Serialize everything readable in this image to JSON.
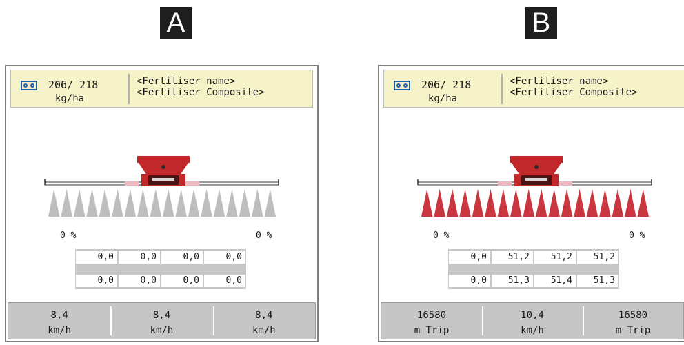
{
  "panels": [
    {
      "letter": "A",
      "rate_value": "206/ 218",
      "rate_unit": "kg/ha",
      "fertiliser_name": "<Fertiliser name>",
      "fertiliser_composite": "<Fertiliser Composite>",
      "spread_active": false,
      "pct_left": "0 %",
      "pct_right": "0 %",
      "grid_row1": [
        "0,0",
        "0,0",
        "0,0",
        "0,0"
      ],
      "grid_row2": [
        "0,0",
        "0,0",
        "0,0",
        "0,0"
      ],
      "footer": [
        {
          "value": "8,4",
          "unit": "km/h"
        },
        {
          "value": "8,4",
          "unit": "km/h"
        },
        {
          "value": "8,4",
          "unit": "km/h"
        }
      ]
    },
    {
      "letter": "B",
      "rate_value": "206/ 218",
      "rate_unit": "kg/ha",
      "fertiliser_name": "<Fertiliser name>",
      "fertiliser_composite": "<Fertiliser Composite>",
      "spread_active": true,
      "pct_left": "0 %",
      "pct_right": "0 %",
      "grid_row1": [
        "0,0",
        "51,2",
        "51,2",
        "51,2"
      ],
      "grid_row2": [
        "0,0",
        "51,3",
        "51,4",
        "51,3"
      ],
      "footer": [
        {
          "value": "16580",
          "unit": "m Trip"
        },
        {
          "value": "10,4",
          "unit": "km/h"
        },
        {
          "value": "16580",
          "unit": "m Trip"
        }
      ]
    }
  ],
  "colors": {
    "header_bg": "#f6f3c8",
    "machine_red": "#c0282b",
    "spread_active": "#c4202a",
    "spread_inactive": "#a8a8a8",
    "rate_icon": "#1f5fa8"
  },
  "icons": {
    "rate": "rate-meter-icon",
    "machine": "spreader-machine-icon",
    "spread": "spread-fan-icon"
  }
}
